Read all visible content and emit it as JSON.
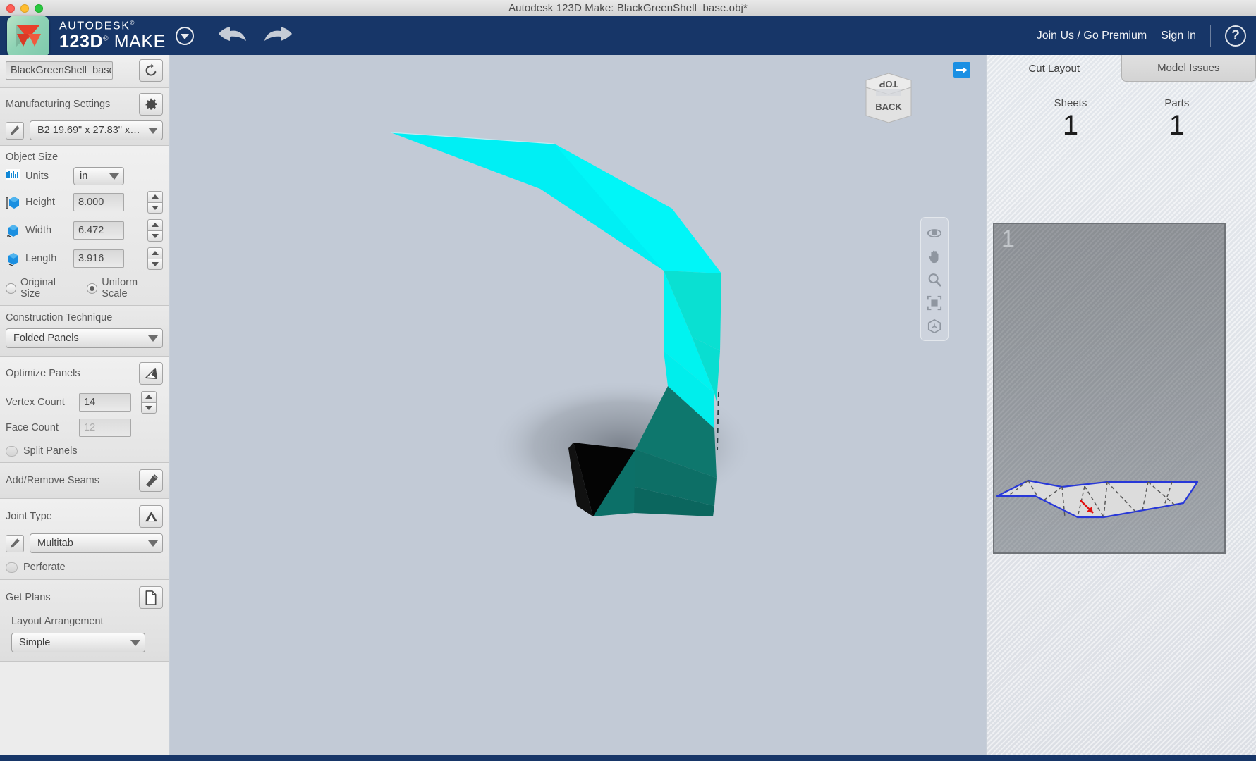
{
  "window": {
    "title": "Autodesk 123D Make: BlackGreenShell_base.obj*",
    "controls": [
      "close",
      "minimize",
      "maximize"
    ]
  },
  "header": {
    "brand_line1": "AUTODESK",
    "brand_line2": "123D",
    "brand_line2b": "MAKE",
    "dropdown_icon": "chevron-down-circle-icon",
    "undo_icon": "undo-arrow-icon",
    "redo_icon": "redo-arrow-icon",
    "join_link": "Join Us / Go Premium",
    "signin_link": "Sign In",
    "help_label": "?",
    "bar_color": "#173668"
  },
  "sidebar": {
    "file_name": "BlackGreenShell_base.",
    "refresh_icon": "refresh-icon",
    "manufacturing": {
      "title": "Manufacturing Settings",
      "gear_icon": "gear-icon",
      "edit_icon": "pencil-icon",
      "material": "B2 19.69\" x 27.83\" x…"
    },
    "object_size": {
      "title": "Object Size",
      "units_label": "Units",
      "units_icon": "ruler-icon",
      "units_value": "in",
      "fields": [
        {
          "label": "Height",
          "value": "8.000",
          "icon": "height-cube-icon"
        },
        {
          "label": "Width",
          "value": "6.472",
          "icon": "width-cube-icon"
        },
        {
          "label": "Length",
          "value": "3.916",
          "icon": "length-cube-icon"
        }
      ],
      "radio_original": "Original Size",
      "radio_uniform": "Uniform Scale",
      "radio_selected": "Uniform Scale"
    },
    "construction": {
      "title": "Construction Technique",
      "value": "Folded Panels"
    },
    "optimize": {
      "title": "Optimize Panels",
      "icon": "panel-optimize-icon",
      "vertex_label": "Vertex Count",
      "vertex_value": "14",
      "face_label": "Face Count",
      "face_value": "12",
      "split_label": "Split Panels"
    },
    "seams": {
      "title": "Add/Remove Seams",
      "icon": "seam-tool-icon"
    },
    "joint": {
      "title": "Joint Type",
      "icon": "joint-tab-icon",
      "edit_icon": "pencil-icon",
      "value": "Multitab",
      "perforate_label": "Perforate"
    },
    "plans": {
      "title": "Get Plans",
      "icon": "document-page-icon",
      "arrangement_label": "Layout Arrangement",
      "arrangement_value": "Simple"
    }
  },
  "viewport": {
    "background": "#c2cad6",
    "expand_icon": "arrow-right-icon",
    "viewcube": {
      "top_face": "TOP",
      "front_face": "BACK"
    },
    "nav_tools": [
      "orbit-icon",
      "pan-hand-icon",
      "zoom-magnifier-icon",
      "fit-to-window-icon",
      "view-cube-icon"
    ],
    "model": {
      "cyan_color": "#00f0f5",
      "cyan_shade_color": "#09e3d4",
      "teal_color": "#0c7068",
      "teal_light_color": "#117e74",
      "black_color": "#050505",
      "shadow_color": "#6e757f"
    }
  },
  "right_panel": {
    "tabs": [
      {
        "label": "Cut Layout",
        "active": true
      },
      {
        "label": "Model Issues",
        "active": false
      }
    ],
    "stats": [
      {
        "label": "Sheets",
        "value": "1"
      },
      {
        "label": "Parts",
        "value": "1"
      }
    ],
    "sheet": {
      "number": "1",
      "outline_color": "#2838d8",
      "fold_line_color": "#585858",
      "fill_color": "#dcdcdc",
      "marker_color": "#e01010",
      "marker_icon": "red-arrow-marker"
    }
  }
}
